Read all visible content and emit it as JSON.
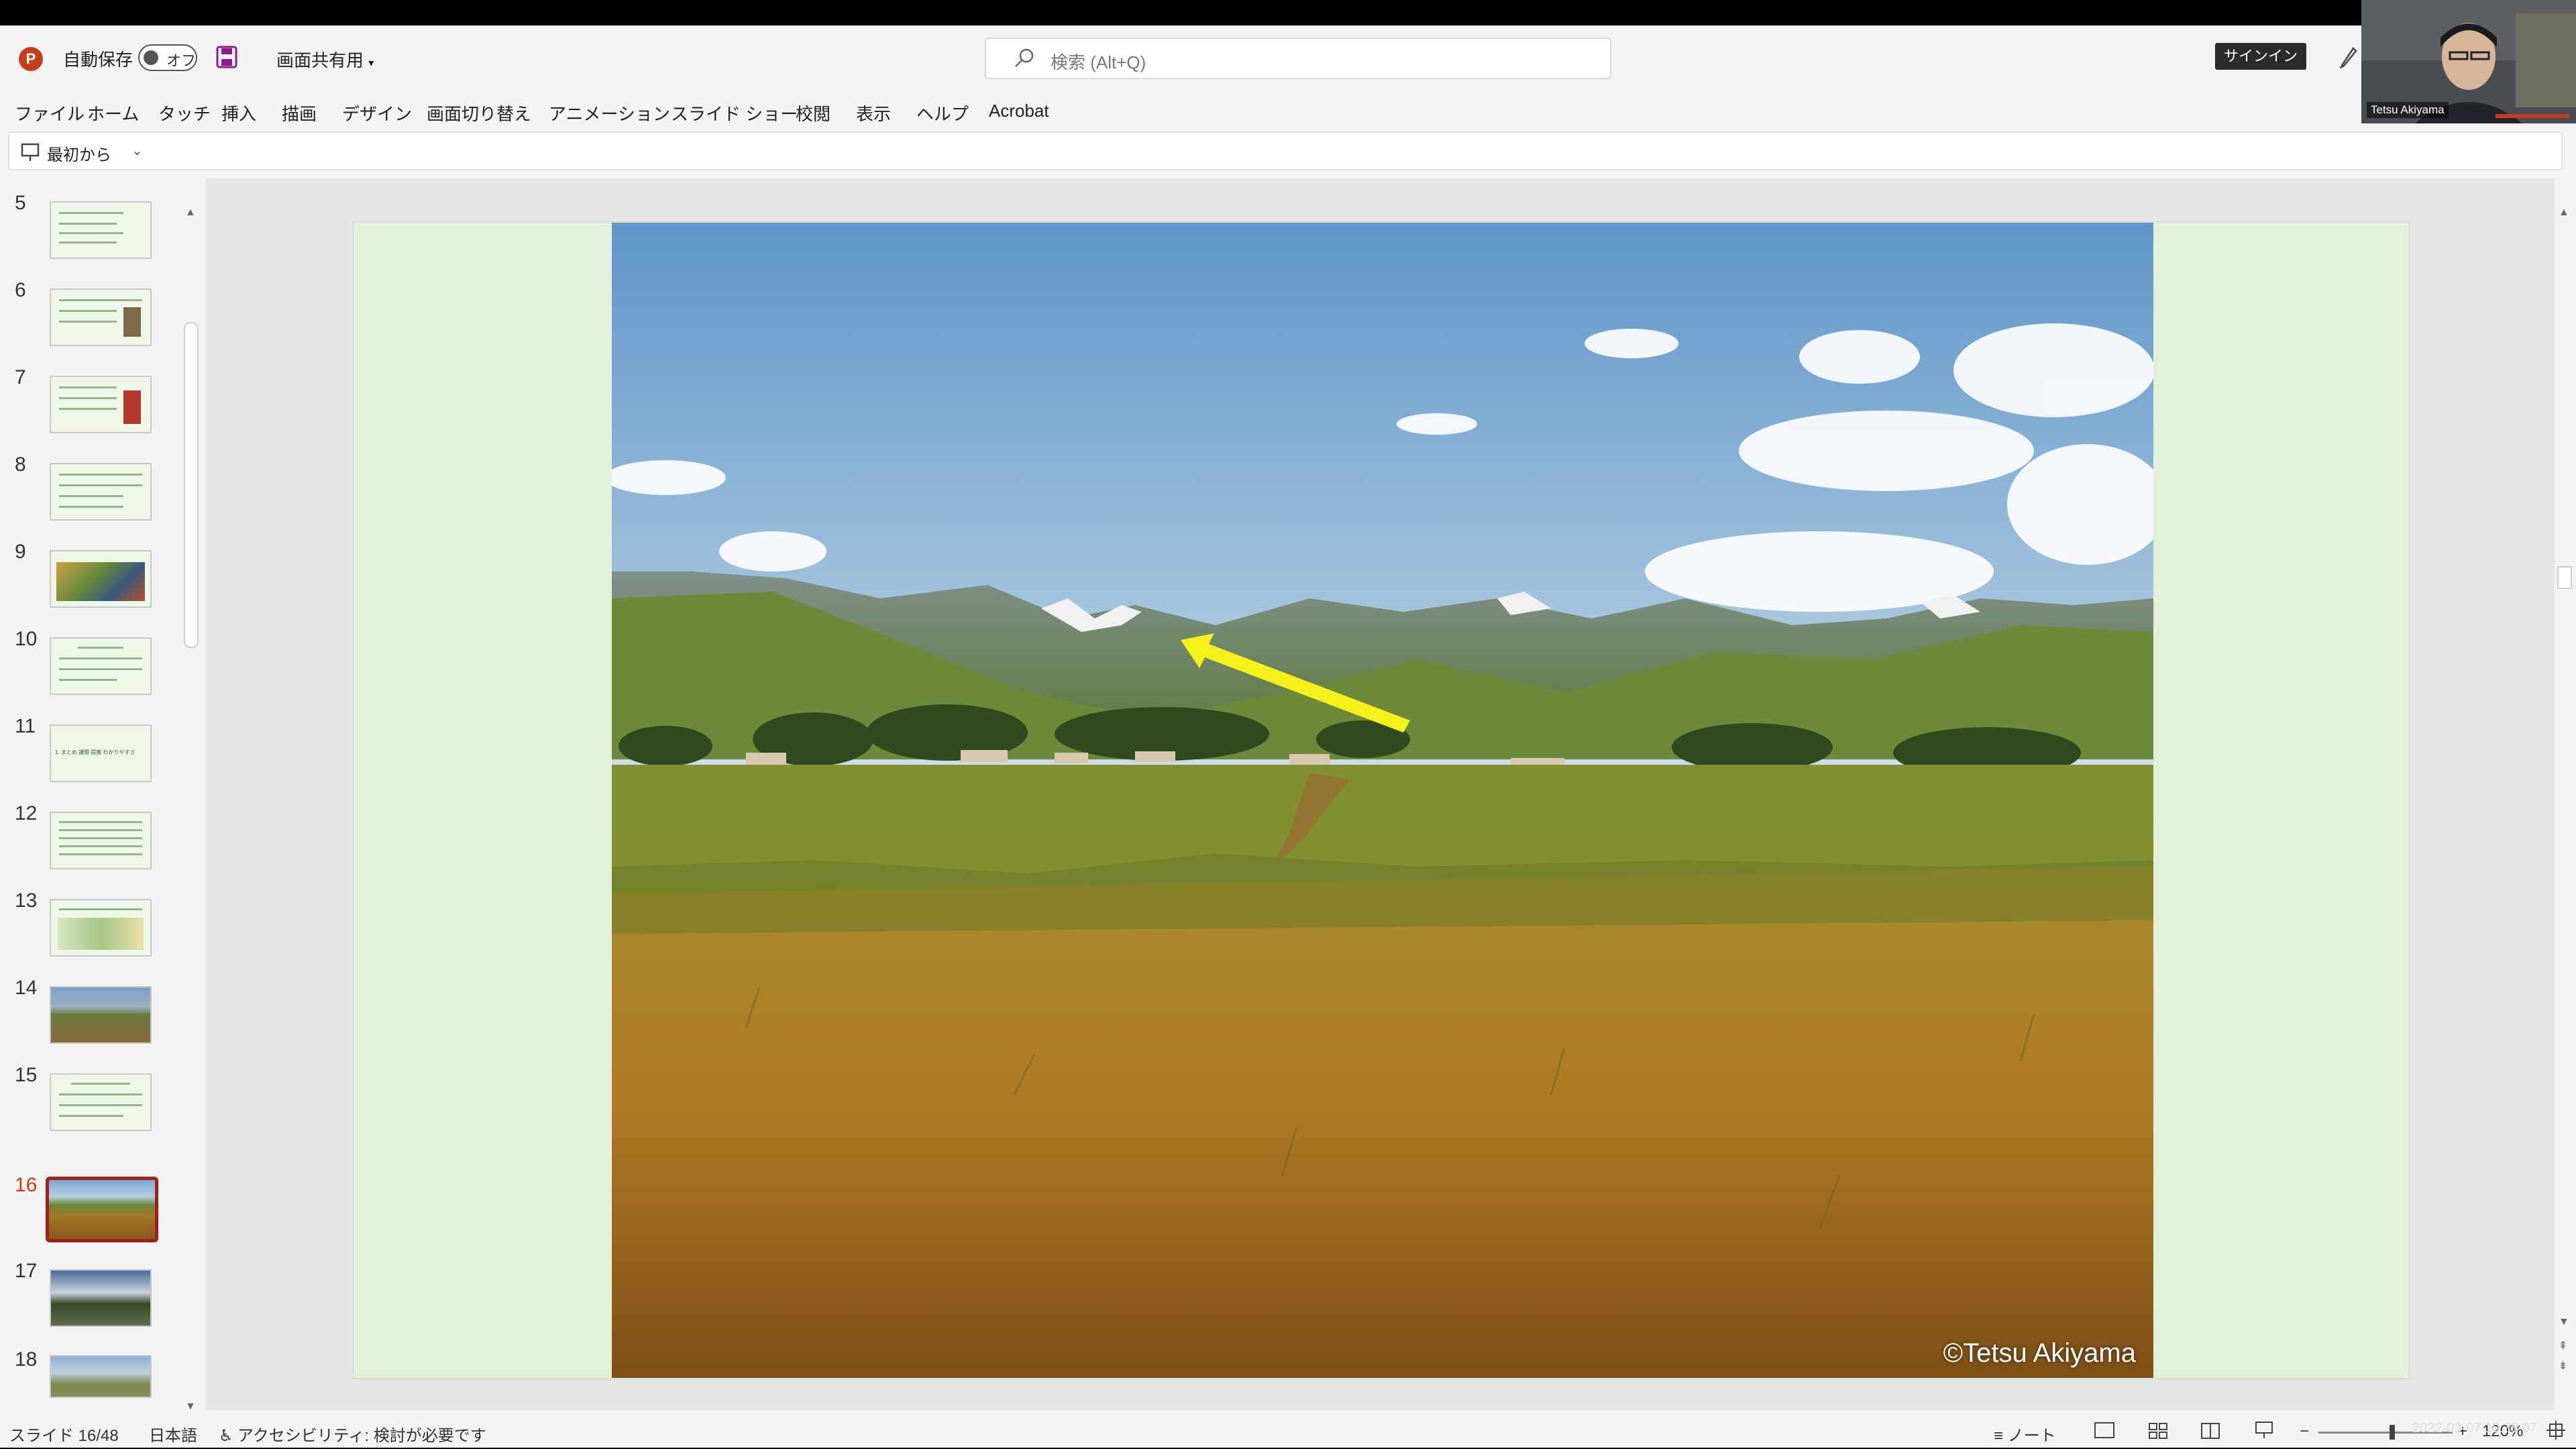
{
  "titlebar": {
    "autosave_label": "自動保存",
    "autosave_state": "オフ",
    "doc_title": "画面共有用",
    "search_placeholder": "検索 (Alt+Q)",
    "signin_label": "サインイン"
  },
  "menu": [
    "ファイル",
    "ホーム",
    "タッチ",
    "挿入",
    "描画",
    "デザイン",
    "画面切り替え",
    "アニメーション",
    "スライド ショー",
    "校閲",
    "表示",
    "ヘルプ",
    "Acrobat"
  ],
  "command_bar": {
    "from_start_label": "最初から"
  },
  "thumbnails": [
    {
      "num": "5"
    },
    {
      "num": "6"
    },
    {
      "num": "7"
    },
    {
      "num": "8"
    },
    {
      "num": "9"
    },
    {
      "num": "10"
    },
    {
      "num": "11",
      "text": "1. まとめ 課題 提案 わかりやすさ"
    },
    {
      "num": "12"
    },
    {
      "num": "13"
    },
    {
      "num": "14"
    },
    {
      "num": "15"
    },
    {
      "num": "16",
      "selected": true
    },
    {
      "num": "17"
    },
    {
      "num": "18"
    }
  ],
  "slide": {
    "photo_credit": "©Tetsu Akiyama"
  },
  "status": {
    "slide_counter": "スライド 16/48",
    "language": "日本語",
    "accessibility": "アクセシビリティ: 検討が必要です",
    "notes_label": "ノート",
    "zoom": "120%"
  },
  "webcam": {
    "name": "Tetsu Akiyama"
  },
  "timestamp": "2022-03-07 10:38:07",
  "colors": {
    "accent": "#c43e1c",
    "selected_thumb_border": "#a41e1e",
    "slide_bg": "#e2f0d9",
    "arrow": "#f5ef1a"
  }
}
